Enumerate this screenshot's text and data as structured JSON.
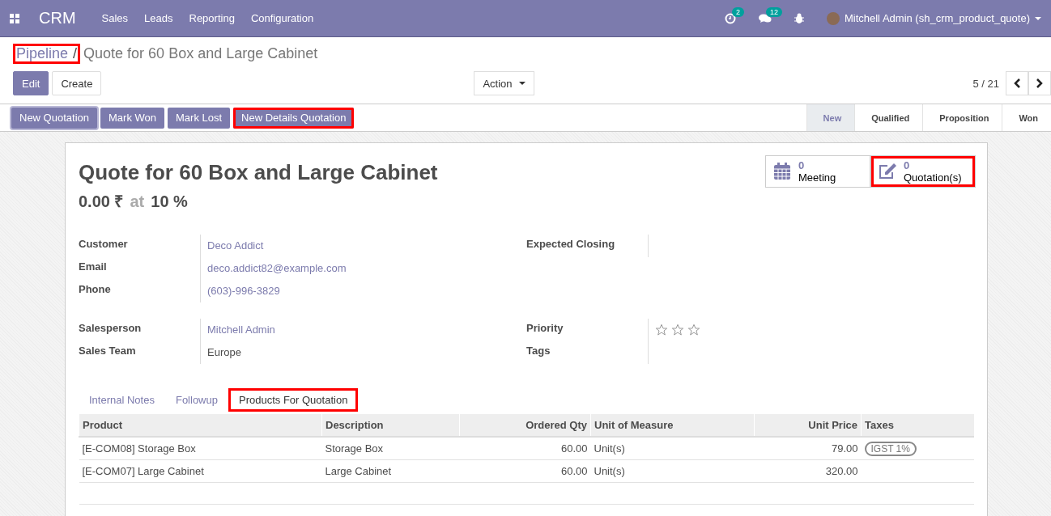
{
  "navbar": {
    "app": "CRM",
    "menu": [
      "Sales",
      "Leads",
      "Reporting",
      "Configuration"
    ],
    "activity_count": "2",
    "message_count": "12",
    "user": "Mitchell Admin (sh_crm_product_quote)"
  },
  "breadcrumb": {
    "parent": "Pipeline",
    "separator": "/",
    "current": "Quote for 60 Box and Large Cabinet",
    "highlighted": true
  },
  "toolbar": {
    "buttons": [
      {
        "label": "Edit",
        "kind": "primary"
      },
      {
        "label": "Create",
        "kind": "secondary"
      }
    ],
    "action": "Action",
    "pager": "5 / 21"
  },
  "header_buttons": [
    {
      "label": "New Quotation",
      "highlighted": false,
      "focused": true
    },
    {
      "label": "Mark Won",
      "highlighted": false,
      "focused": false
    },
    {
      "label": "Mark Lost",
      "highlighted": false,
      "focused": false
    },
    {
      "label": "New Details Quotation",
      "highlighted": true,
      "focused": false
    }
  ],
  "stages": [
    {
      "label": "New",
      "selected": true
    },
    {
      "label": "Qualified",
      "selected": false
    },
    {
      "label": "Proposition",
      "selected": false
    },
    {
      "label": "Won",
      "selected": false
    }
  ],
  "smart_buttons": [
    {
      "kind": "calendar",
      "count": "0",
      "label": "Meeting",
      "highlighted": false
    },
    {
      "kind": "edit",
      "count": "0",
      "label": "Quotation(s)",
      "highlighted": true
    }
  ],
  "title": "Quote for 60 Box and Large Cabinet",
  "revenue": {
    "amount": "0.00 ₹",
    "at": "at",
    "probability": "10 %"
  },
  "left_groups": [
    [
      {
        "label": "Customer",
        "value": "Deco Addict",
        "link": true
      },
      {
        "label": "Email",
        "value": "deco.addict82@example.com",
        "link": true
      },
      {
        "label": "Phone",
        "value": "(603)-996-3829",
        "link": true
      }
    ],
    [
      {
        "label": "Salesperson",
        "value": "Mitchell Admin",
        "link": true
      },
      {
        "label": "Sales Team",
        "value": "Europe",
        "link": false
      }
    ]
  ],
  "expected_closing": {
    "label": "Expected Closing"
  },
  "priority": {
    "label": "Priority",
    "stars": 0
  },
  "tags": {
    "label": "Tags"
  },
  "tabs": [
    {
      "label": "Internal Notes",
      "selected": false,
      "highlighted": false
    },
    {
      "label": "Followup",
      "selected": false,
      "highlighted": false
    },
    {
      "label": "Products For Quotation",
      "selected": true,
      "highlighted": true
    }
  ],
  "table": {
    "columns": [
      "Product",
      "Description",
      "Ordered Qty",
      "Unit of Measure",
      "Unit Price",
      "Taxes"
    ],
    "rows": [
      {
        "product": "[E-COM08] Storage Box",
        "description": "Storage Box",
        "qty": "60.00",
        "uom": "Unit(s)",
        "price": "79.00",
        "taxes": [
          "IGST 1%"
        ]
      },
      {
        "product": "[E-COM07] Large Cabinet",
        "description": "Large Cabinet",
        "qty": "60.00",
        "uom": "Unit(s)",
        "price": "320.00",
        "taxes": []
      }
    ]
  }
}
